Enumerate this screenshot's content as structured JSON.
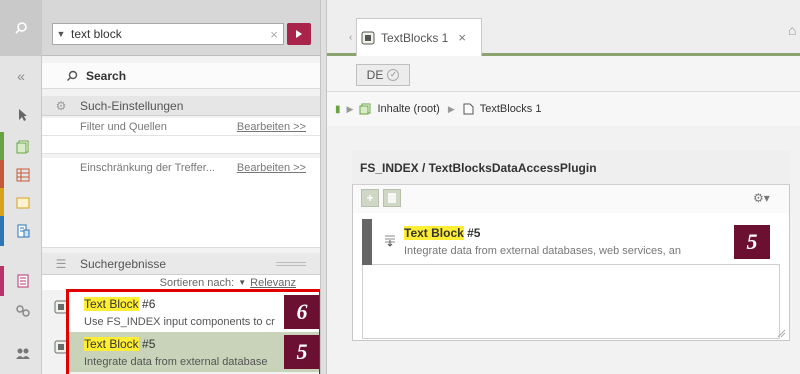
{
  "search": {
    "query": "text block",
    "title": "Search",
    "settings_header": "Such-Einstellungen",
    "filter_label": "Filter und Quellen",
    "filter_edit": "Bearbeiten >>",
    "restrict_label": "Einschränkung der Treffer...",
    "restrict_edit": "Bearbeiten >>",
    "results_header": "Suchergebnisse",
    "sort_label": "Sortieren nach:",
    "sort_value": "Relevanz"
  },
  "results": [
    {
      "hl": "Text Block",
      "rest": " #6",
      "desc": "Use FS_INDEX input components to cr",
      "badge": "6"
    },
    {
      "hl": "Text Block",
      "rest": " #5",
      "desc": "Integrate data from external database",
      "badge": "5"
    }
  ],
  "tab": {
    "label": "TextBlocks 1"
  },
  "language": {
    "code": "DE"
  },
  "breadcrumb": {
    "root": "Inhalte (root)",
    "current": "TextBlocks 1"
  },
  "plugin": {
    "title": "FS_INDEX / TextBlocksDataAccessPlugin",
    "entry": {
      "hl": "Text Block",
      "rest": " #5",
      "desc": "Integrate data from external databases, web services, an",
      "badge": "5"
    }
  },
  "colors": {
    "accent": "#a8244b",
    "badge": "#6b1030",
    "tab_border": "#8ba36f",
    "highlight": "#ffee33",
    "selection_box": "#e10000"
  }
}
